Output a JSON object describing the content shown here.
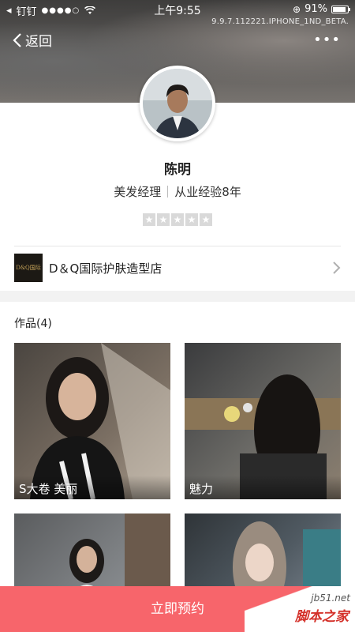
{
  "status_bar": {
    "carrier": "钉钉",
    "time": "上午9:55",
    "battery_percent": "91%",
    "battery_level": 0.91,
    "version_text": "9.9.7.112221.IPHONE_1ND_BETA."
  },
  "nav": {
    "back_label": "返回",
    "more_label": "•••"
  },
  "profile": {
    "name": "陈明",
    "title": "美发经理",
    "experience": "从业经验8年",
    "rating_stars": 5,
    "rating_filled": 0
  },
  "store": {
    "logo_text": "D&Q国际",
    "name": "D＆Q国际护肤造型店"
  },
  "works": {
    "title": "作品(4)",
    "items": [
      {
        "caption": "S大卷 美丽"
      },
      {
        "caption": "魅力"
      },
      {
        "caption": ""
      },
      {
        "caption": ""
      }
    ]
  },
  "footer": {
    "book_label": "立即预约"
  },
  "watermark": {
    "url": "jb51.net",
    "text": "脚本之家"
  },
  "colors": {
    "accent": "#f7656b",
    "star_empty": "#d9d9d9",
    "section_gap": "#f2f2f2"
  }
}
